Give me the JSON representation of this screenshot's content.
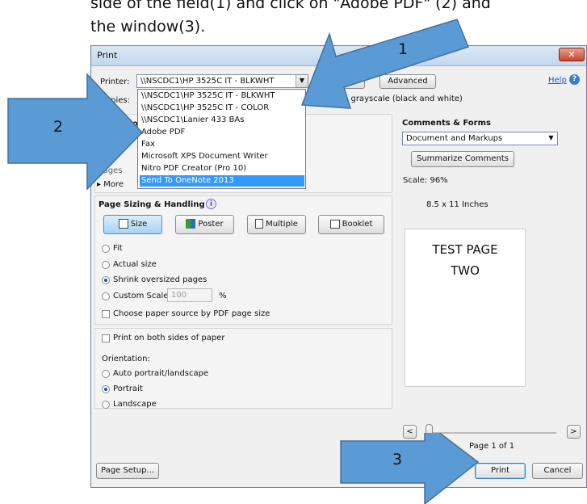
{
  "caption": {
    "line1": "side of the field(1) and click on \"Adobe PDF\" (2) and",
    "line2": "the window(3)."
  },
  "dialog": {
    "title": "Print",
    "close_symbol": "✕",
    "help_label": "Help",
    "help_icon_glyph": "?",
    "printer_label": "Printer:",
    "printer_value": "\\\\NSCDC1\\HP 3525C IT - BLKWHT",
    "copies_label": "Copies:",
    "advanced_label": "Advanced",
    "print_grayscale_label": "Print in grayscale (black and white)",
    "pages_to_print_partial": "Pages to",
    "printer_dropdown_options": [
      "\\\\NSCDC1\\HP 3525C IT - BLKWHT",
      "\\\\NSCDC1\\HP 3525C IT - COLOR",
      "\\\\NSCDC1\\Lanier 433 BAs",
      "Adobe PDF",
      "Fax",
      "Microsoft XPS Document Writer",
      "Nitro PDF Creator (Pro 10)",
      "Send To OneNote 2013"
    ],
    "partial_current": "rrer",
    "partial_pages": "Pages",
    "partial_more": "More",
    "page_sizing": {
      "heading": "Page Sizing & Handling",
      "info_glyph": "i",
      "buttons": [
        "Size",
        "Poster",
        "Multiple",
        "Booklet"
      ],
      "options": [
        "Fit",
        "Actual size",
        "Shrink oversized pages",
        "Custom Scale:"
      ],
      "custom_scale_value": "100",
      "percent": "%",
      "paper_source_label": "Choose paper source by PDF page size"
    },
    "both_sides_label": "Print on both sides of paper",
    "orientation": {
      "label": "Orientation:",
      "options": [
        "Auto portrait/landscape",
        "Portrait",
        "Landscape"
      ]
    },
    "comments_forms": {
      "heading": "Comments & Forms",
      "value": "Document and Markups",
      "summarize_label": "Summarize Comments"
    },
    "scale_label": "Scale: 96%",
    "paper_size_label": "8.5 x 11 Inches",
    "preview_text_line1": "TEST PAGE",
    "preview_text_line2": "TWO",
    "nav_prev": "<",
    "nav_next": ">",
    "page_indicator": "Page 1 of 1",
    "page_setup_label": "Page Setup...",
    "print_label": "Print",
    "cancel_label": "Cancel"
  },
  "annotations": {
    "arrow1_label": "1",
    "arrow2_label": "2",
    "arrow3_label": "3",
    "arrow_color": "#5b9bd5",
    "arrow_stroke": "#41719c"
  }
}
